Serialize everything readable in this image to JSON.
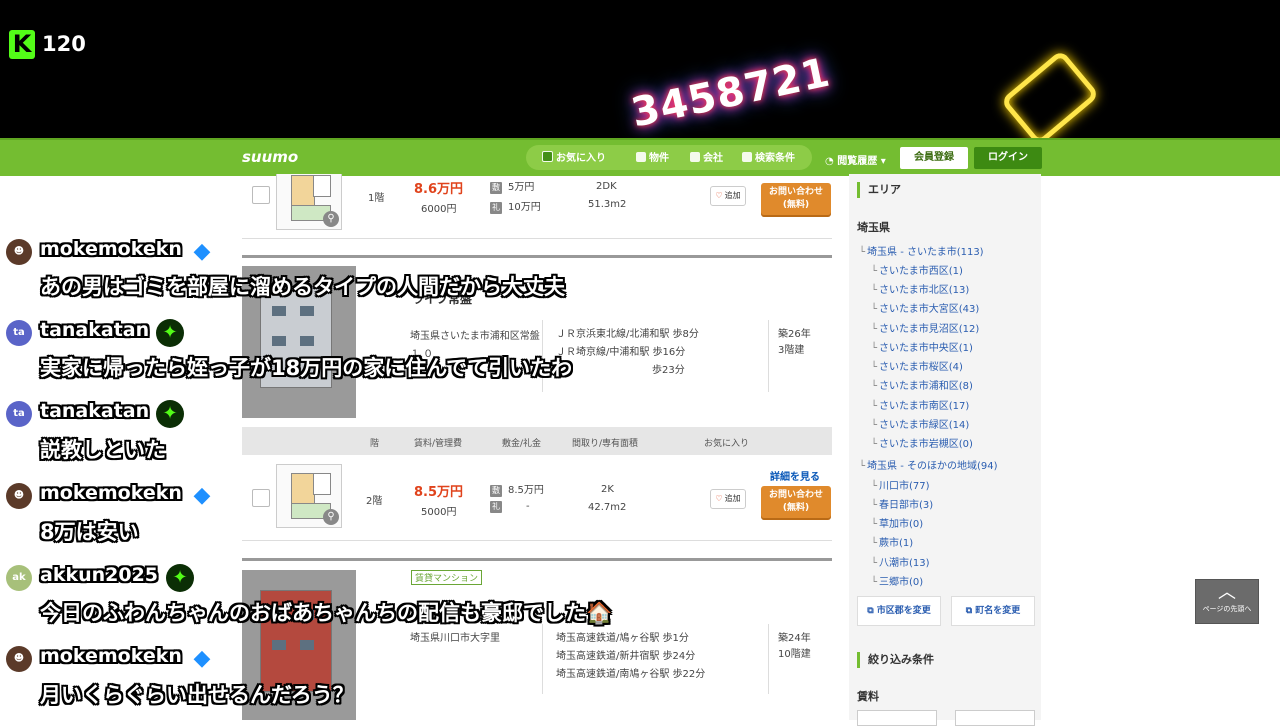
{
  "stream": {
    "viewer_count": "120",
    "kick_logo": "K",
    "neon_number": "3458721"
  },
  "header": {
    "logo": "suumo",
    "nav": [
      {
        "label": "お気に入り",
        "icon": "checkbox-icon"
      },
      {
        "label": "物件",
        "icon": "house-icon"
      },
      {
        "label": "会社",
        "icon": "building-icon"
      },
      {
        "label": "検索条件",
        "icon": "search-icon"
      }
    ],
    "history": "閲覧履歴",
    "register": "会員登録",
    "login": "ログイン"
  },
  "listings": {
    "row1": {
      "floor": "1階",
      "rent": "8.6万円",
      "mgmt": "6000円",
      "deposit": "5万円",
      "key_money": "10万円",
      "layout": "2DK",
      "area": "51.3m2",
      "fav": "追加",
      "inquiry_line1": "お問い合わせ",
      "inquiry_line2": "(無料)"
    },
    "building1": {
      "name": "ライフ常盤",
      "address": "埼玉県さいたま市浦和区常盤１.０",
      "access": [
        "ＪＲ京浜東北線/北浦和駅 歩8分",
        "ＪＲ埼京線/中浦和駅 歩16分",
        "歩23分"
      ],
      "age": "築26年",
      "stories": "3階建"
    },
    "table_header": {
      "floor": "階",
      "rent": "賃料/管理費",
      "deposit": "敷金/礼金",
      "layout": "間取り/専有面積",
      "fav": "お気に入り"
    },
    "row2": {
      "floor": "2階",
      "rent": "8.5万円",
      "mgmt": "5000円",
      "deposit": "8.5万円",
      "key_money": "-",
      "layout": "2K",
      "area": "42.7m2",
      "fav": "追加",
      "detail": "詳細を見る",
      "inquiry_line1": "お問い合わせ",
      "inquiry_line2": "(無料)"
    },
    "building2": {
      "type": "賃貸マンション",
      "address": "埼玉県川口市大字里",
      "access": [
        "埼玉高速鉄道/鳩ヶ谷駅 歩1分",
        "埼玉高速鉄道/新井宿駅 歩24分",
        "埼玉高速鉄道/南鳩ヶ谷駅 歩22分"
      ],
      "age": "築24年",
      "stories": "10階建"
    },
    "deposit_tag": "敷",
    "key_tag": "礼"
  },
  "sidebar": {
    "area_title": "エリア",
    "prefecture": "埼玉県",
    "groups": [
      {
        "label": "埼玉県 - さいたま市(113)",
        "children": [
          "さいたま市西区(1)",
          "さいたま市北区(13)",
          "さいたま市大宮区(43)",
          "さいたま市見沼区(12)",
          "さいたま市中央区(1)",
          "さいたま市桜区(4)",
          "さいたま市浦和区(8)",
          "さいたま市南区(17)",
          "さいたま市緑区(14)",
          "さいたま市岩槻区(0)"
        ]
      },
      {
        "label": "埼玉県 - そのほかの地域(94)",
        "children": [
          "川口市(77)",
          "春日部市(3)",
          "草加市(0)",
          "蕨市(1)",
          "八潮市(13)",
          "三郷市(0)"
        ]
      }
    ],
    "btn_city": "市区郡を変更",
    "btn_town": "町名を変更",
    "filter_title": "絞り込み条件",
    "rent_label": "賃料"
  },
  "page_top": "ページの先頭へ",
  "chat": [
    {
      "user": "mokemokekn",
      "badge": "cube",
      "message": "あの男はゴミを部屋に溜めるタイプの人間だから大丈夫"
    },
    {
      "user": "tanakatan",
      "badge": "star",
      "avatar": "ta",
      "message": "実家に帰ったら姪っ子が18万円の家に住んでて引いたわ"
    },
    {
      "user": "tanakatan",
      "badge": "star",
      "avatar": "ta",
      "message": "説教しといた"
    },
    {
      "user": "mokemokekn",
      "badge": "cube",
      "message": "8万は安い"
    },
    {
      "user": "akkun2025",
      "badge": "star",
      "avatar": "ak",
      "message": "今日のふわんちゃんのおばあちゃんちの配信も豪邸でした🏠"
    },
    {
      "user": "mokemokekn",
      "badge": "cube",
      "message": "月いくらぐらい出せるんだろう？"
    }
  ],
  "colors": {
    "header_green": "#74bd31",
    "price_red": "#e0431c",
    "inquiry_orange": "#e08a2c",
    "kick_green": "#53fc18"
  }
}
